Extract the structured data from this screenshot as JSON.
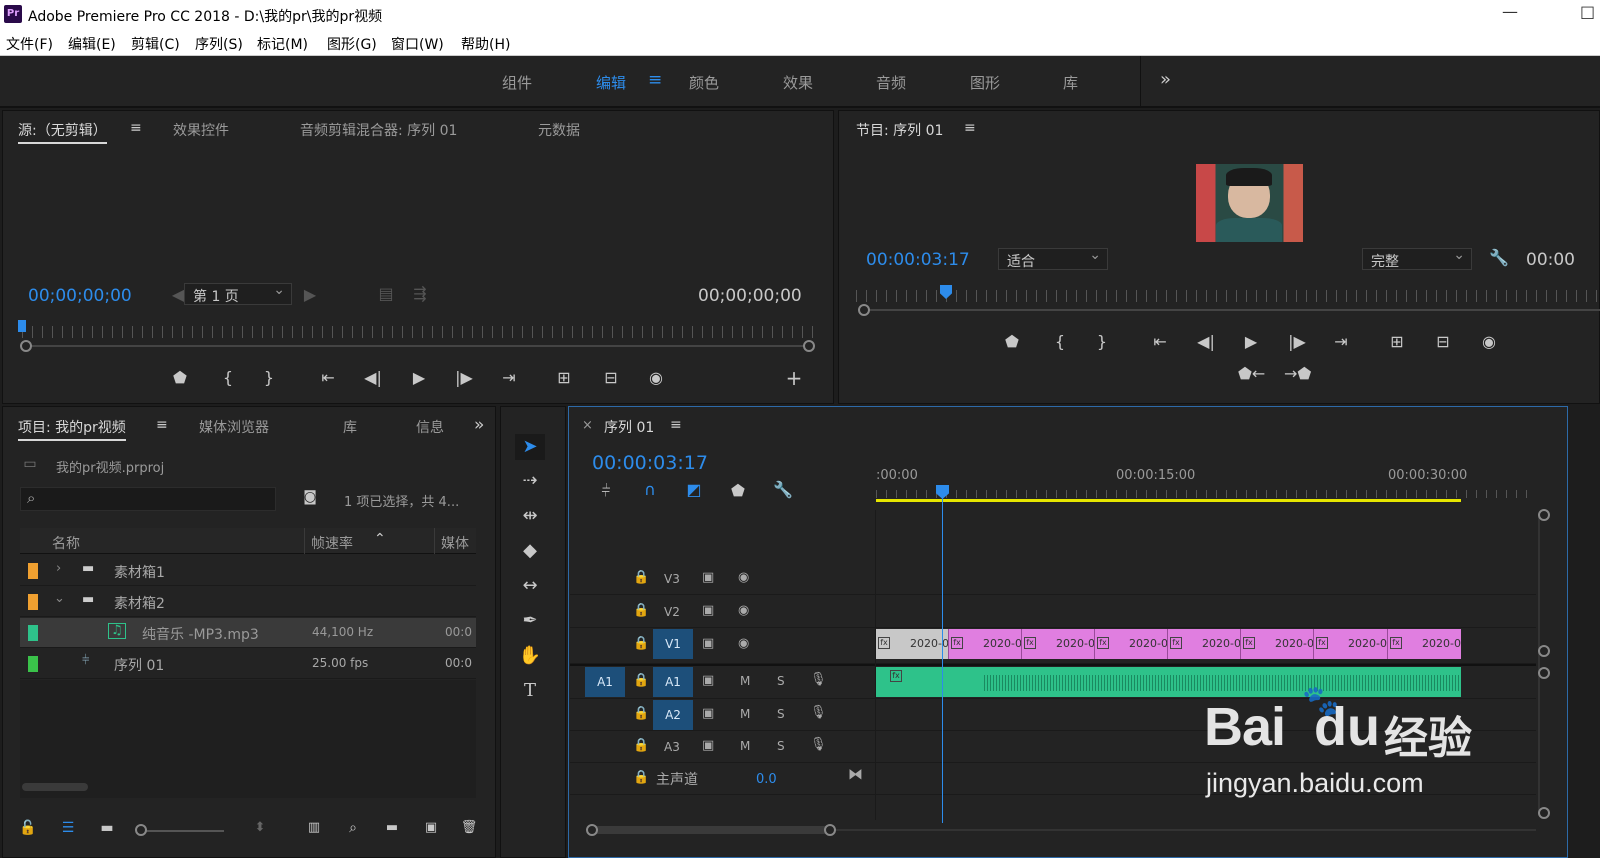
{
  "window": {
    "app_label": "Pr",
    "title": "Adobe Premiere Pro CC 2018 - D:\\我的pr\\我的pr视频",
    "minimize": "—",
    "maximize": "□"
  },
  "menu": [
    "文件(F)",
    "编辑(E)",
    "剪辑(C)",
    "序列(S)",
    "标记(M)",
    "图形(G)",
    "窗口(W)",
    "帮助(H)"
  ],
  "workspaces": {
    "items": [
      "组件",
      "编辑",
      "颜色",
      "效果",
      "音频",
      "图形",
      "库"
    ],
    "active": "编辑",
    "menu_icon": "≡",
    "overflow": "»"
  },
  "source_panel": {
    "tabs": [
      "源:（无剪辑）",
      "效果控件",
      "音频剪辑混合器: 序列 01",
      "元数据"
    ],
    "menu_icon": "≡",
    "timecode_left": "00;00;00;00",
    "timecode_right": "00;00;00;00",
    "page_select": "第 1 页",
    "add": "+"
  },
  "program_panel": {
    "tab": "节目: 序列 01",
    "menu_icon": "≡",
    "timecode": "00:00:03:17",
    "fit_select": "适合",
    "quality_select": "完整",
    "timecode_right": "00:00"
  },
  "project_panel": {
    "tabs": [
      "项目: 我的pr视频",
      "媒体浏览器",
      "库",
      "信息"
    ],
    "menu_icon": "≡",
    "overflow": "»",
    "file": "我的pr视频.prproj",
    "search_icon": "⌕",
    "selection_info": "1 项已选择，共 4...",
    "columns": [
      "名称",
      "帧速率",
      "媒体"
    ],
    "rows": [
      {
        "name": "素材箱1",
        "rate": "",
        "media": "",
        "color": "#f0a030",
        "kind": "bin",
        "expanded": false
      },
      {
        "name": "素材箱2",
        "rate": "",
        "media": "",
        "color": "#f0a030",
        "kind": "bin",
        "expanded": true
      },
      {
        "name": "纯音乐 -MP3.mp3",
        "rate": "44,100 Hz",
        "media": "00:0",
        "color": "#2ec28a",
        "kind": "audio",
        "selected": true
      },
      {
        "name": "序列 01",
        "rate": "25.00 fps",
        "media": "00:0",
        "color": "#3ac24a",
        "kind": "sequence"
      }
    ]
  },
  "timeline": {
    "tab": "序列 01",
    "close": "×",
    "menu_icon": "≡",
    "timecode": "00:00:03:17",
    "ruler_labels": [
      ":00:00",
      "00:00:15:00",
      "00:00:30:00"
    ],
    "video_tracks": [
      {
        "label": "V3",
        "toggle": "",
        "lock": "🔒"
      },
      {
        "label": "V2",
        "toggle": "",
        "lock": "🔒"
      },
      {
        "label": "V1",
        "toggle": "",
        "lock": "🔒"
      }
    ],
    "audio_tracks": [
      {
        "label": "A1",
        "source": "A1",
        "m": "M",
        "s": "S"
      },
      {
        "label": "A2",
        "source": "",
        "m": "M",
        "s": "S"
      },
      {
        "label": "A3",
        "source": "",
        "m": "M",
        "s": "S"
      }
    ],
    "master": {
      "label": "主声道",
      "value": "0.0"
    },
    "clips": [
      "2020-0",
      "2020-0",
      "2020-0",
      "2020-0",
      "2020-0",
      "2020-0",
      "2020-0",
      "2020-0"
    ],
    "fx_label": "fx"
  },
  "watermark": {
    "text": "Bai",
    "brand2": "du",
    "suffix": "经验",
    "url": "jingyan.baidu.com"
  },
  "colors": {
    "accent": "#2d8ceb",
    "clip_video": "#e07ee0",
    "clip_audio": "#2ec28a",
    "work_area": "#e6e600",
    "playhead": "#2d8ceb"
  }
}
